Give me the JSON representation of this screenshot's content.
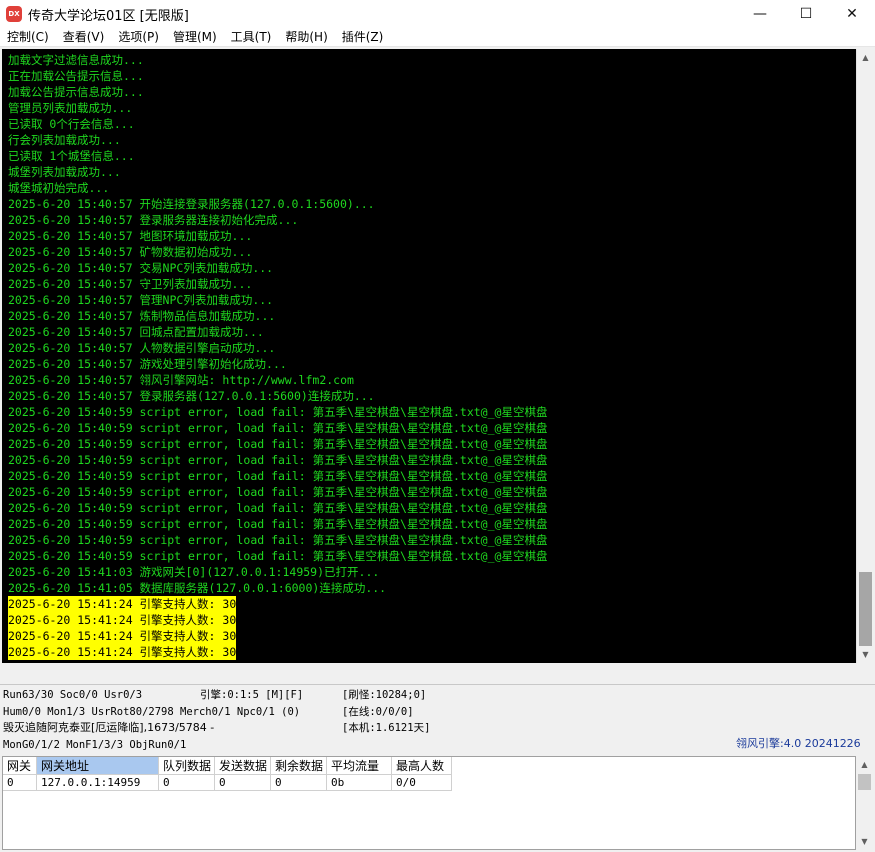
{
  "window": {
    "icon_text": "DX",
    "title": "传奇大学论坛01区 [无限版]",
    "min": "—",
    "max": "☐",
    "close": "✕"
  },
  "menu": [
    "控制(C)",
    "查看(V)",
    "选项(P)",
    "管理(M)",
    "工具(T)",
    "帮助(H)",
    "插件(Z)"
  ],
  "console": {
    "lines": [
      "加载文字过滤信息成功...",
      "正在加载公告提示信息...",
      "加载公告提示信息成功...",
      "管理员列表加载成功...",
      "已读取 0个行会信息...",
      "行会列表加载成功...",
      "已读取 1个城堡信息...",
      "城堡列表加载成功...",
      "城堡城初始完成...",
      "2025-6-20 15:40:57 开始连接登录服务器(127.0.0.1:5600)...",
      "2025-6-20 15:40:57 登录服务器连接初始化完成...",
      "2025-6-20 15:40:57 地图环境加载成功...",
      "2025-6-20 15:40:57 矿物数据初始成功...",
      "2025-6-20 15:40:57 交易NPC列表加载成功...",
      "2025-6-20 15:40:57 守卫列表加载成功...",
      "2025-6-20 15:40:57 管理NPC列表加载成功...",
      "2025-6-20 15:40:57 炼制物品信息加载成功...",
      "2025-6-20 15:40:57 回城点配置加载成功...",
      "2025-6-20 15:40:57 人物数据引擎启动成功...",
      "2025-6-20 15:40:57 游戏处理引擎初始化成功...",
      "2025-6-20 15:40:57 翎风引擎网站: http://www.lfm2.com",
      "2025-6-20 15:40:57 登录服务器(127.0.0.1:5600)连接成功...",
      "2025-6-20 15:40:59 script error, load fail: 第五季\\星空棋盘\\星空棋盘.txt@_@星空棋盘",
      "2025-6-20 15:40:59 script error, load fail: 第五季\\星空棋盘\\星空棋盘.txt@_@星空棋盘",
      "2025-6-20 15:40:59 script error, load fail: 第五季\\星空棋盘\\星空棋盘.txt@_@星空棋盘",
      "2025-6-20 15:40:59 script error, load fail: 第五季\\星空棋盘\\星空棋盘.txt@_@星空棋盘",
      "2025-6-20 15:40:59 script error, load fail: 第五季\\星空棋盘\\星空棋盘.txt@_@星空棋盘",
      "2025-6-20 15:40:59 script error, load fail: 第五季\\星空棋盘\\星空棋盘.txt@_@星空棋盘",
      "2025-6-20 15:40:59 script error, load fail: 第五季\\星空棋盘\\星空棋盘.txt@_@星空棋盘",
      "2025-6-20 15:40:59 script error, load fail: 第五季\\星空棋盘\\星空棋盘.txt@_@星空棋盘",
      "2025-6-20 15:40:59 script error, load fail: 第五季\\星空棋盘\\星空棋盘.txt@_@星空棋盘",
      "2025-6-20 15:40:59 script error, load fail: 第五季\\星空棋盘\\星空棋盘.txt@_@星空棋盘",
      "2025-6-20 15:41:03 游戏网关[0](127.0.0.1:14959)已打开...",
      "2025-6-20 15:41:05 数据库服务器(127.0.0.1:6000)连接成功..."
    ],
    "highlight_lines": [
      "2025-6-20 15:41:24 引擎支持人数: 30",
      "2025-6-20 15:41:24 引擎支持人数: 30",
      "2025-6-20 15:41:24 引擎支持人数: 30",
      "2025-6-20 15:41:24 引擎支持人数: 30"
    ],
    "text_color": "#1fd81f",
    "highlight_color": "#ffff00"
  },
  "status": {
    "run": "Run63/30 Soc0/0 Usr0/3",
    "engine": "引擎:0:1:5 [M][F]",
    "refresh": "[刷怪:10284;0]",
    "hum": "Hum0/0 Mon1/3 UsrRot80/2798 Merch0/1 Npc0/1 (0)",
    "online": "[在线:0/0/0]",
    "event": "毁灭追随阿克泰亚[厄运降临],1673/5784 -",
    "local": "[本机:1.6121天]",
    "mon": "MonG0/1/2 MonF1/3/3 ObjRun0/1",
    "version": "翎风引擎:4.0 20241226"
  },
  "grid": {
    "headers": [
      "网关",
      "网关地址",
      "队列数据",
      "发送数据",
      "剩余数据",
      "平均流量",
      "最高人数"
    ],
    "rows": [
      [
        "0",
        "127.0.0.1:14959",
        "0",
        "0",
        "0",
        "0b",
        "0/0"
      ]
    ]
  }
}
